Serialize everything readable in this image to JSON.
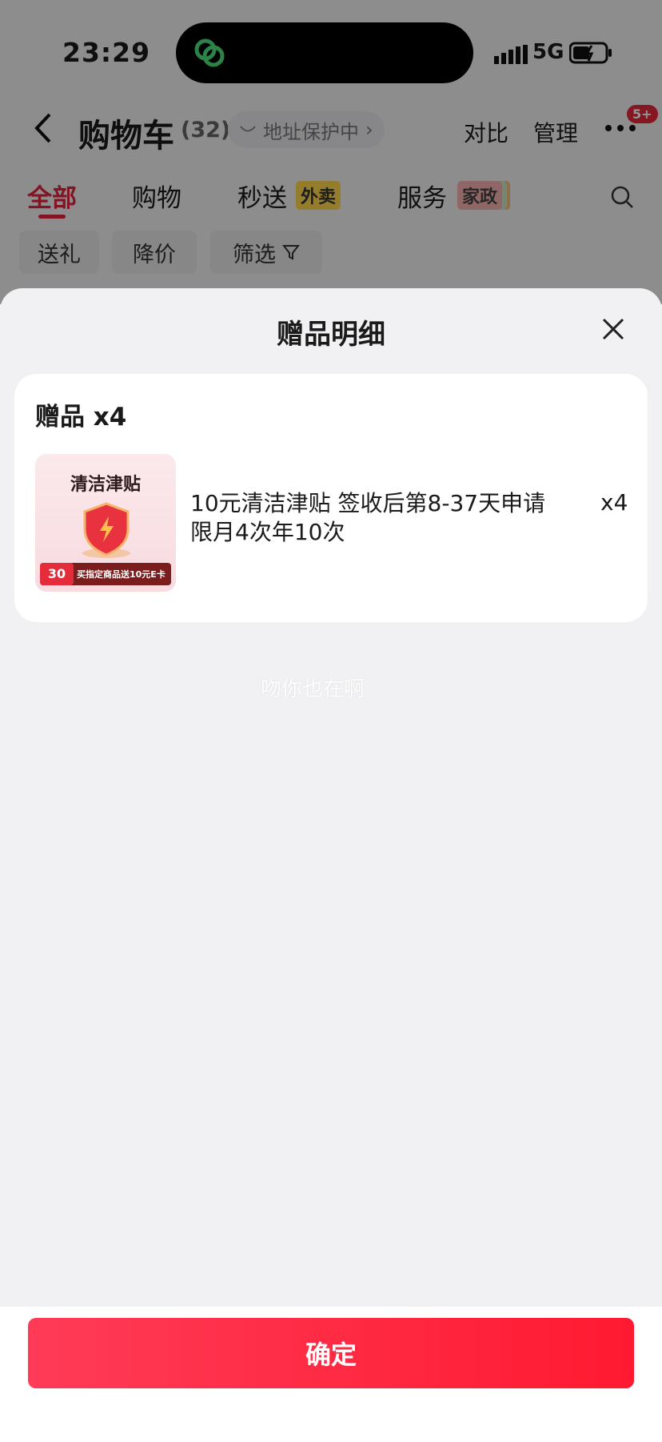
{
  "status_bar": {
    "time": "23:29",
    "network": "5G"
  },
  "nav": {
    "title": "购物车",
    "count": "(32)",
    "address_label": "地址保护中",
    "compare": "对比",
    "manage": "管理",
    "badge": "5+"
  },
  "tabs": [
    {
      "label": "全部"
    },
    {
      "label": "购物"
    },
    {
      "label": "秒送",
      "tag": "外卖"
    },
    {
      "label": "服务",
      "tag": "家政"
    }
  ],
  "filters": [
    "送礼",
    "降价",
    "筛选"
  ],
  "sheet": {
    "title": "赠品明细",
    "gift_header": "赠品 x4",
    "item": {
      "image_title": "清洁津贴",
      "image_badge": "30",
      "image_caption": "买指定商品送10元E卡",
      "description": "10元清洁津贴 签收后第8-37天申请限月4次年10次",
      "quantity": "x4"
    },
    "watermark": "吻你也在啊",
    "confirm": "确定"
  },
  "colors": {
    "accent": "#e2233d",
    "confirm_start": "#ff3b57",
    "confirm_end": "#ff1a31"
  }
}
